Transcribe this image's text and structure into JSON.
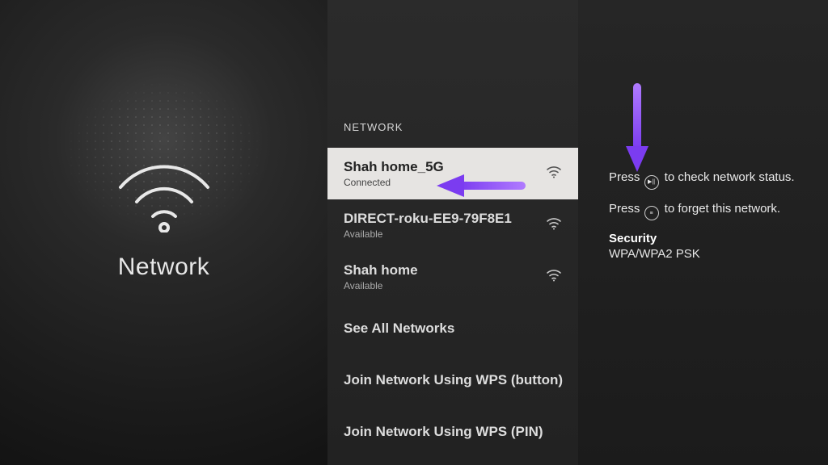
{
  "left": {
    "title": "Network"
  },
  "middle": {
    "header": "NETWORK",
    "networks": [
      {
        "name": "Shah home_5G",
        "status": "Connected",
        "selected": true
      },
      {
        "name": "DIRECT-roku-EE9-79F8E1",
        "status": "Available",
        "selected": false
      },
      {
        "name": "Shah home",
        "status": "Available",
        "selected": false
      }
    ],
    "actions": {
      "see_all": "See All Networks",
      "wps_button": "Join Network Using WPS (button)",
      "wps_pin": "Join Network Using WPS (PIN)"
    }
  },
  "right": {
    "hint1_pre": "Press ",
    "hint1_post": " to check network status.",
    "hint2_pre": "Press ",
    "hint2_post": " to forget this network.",
    "security_label": "Security",
    "security_value": "WPA/WPA2 PSK"
  },
  "colors": {
    "accent_arrow": "#8a4bff"
  }
}
